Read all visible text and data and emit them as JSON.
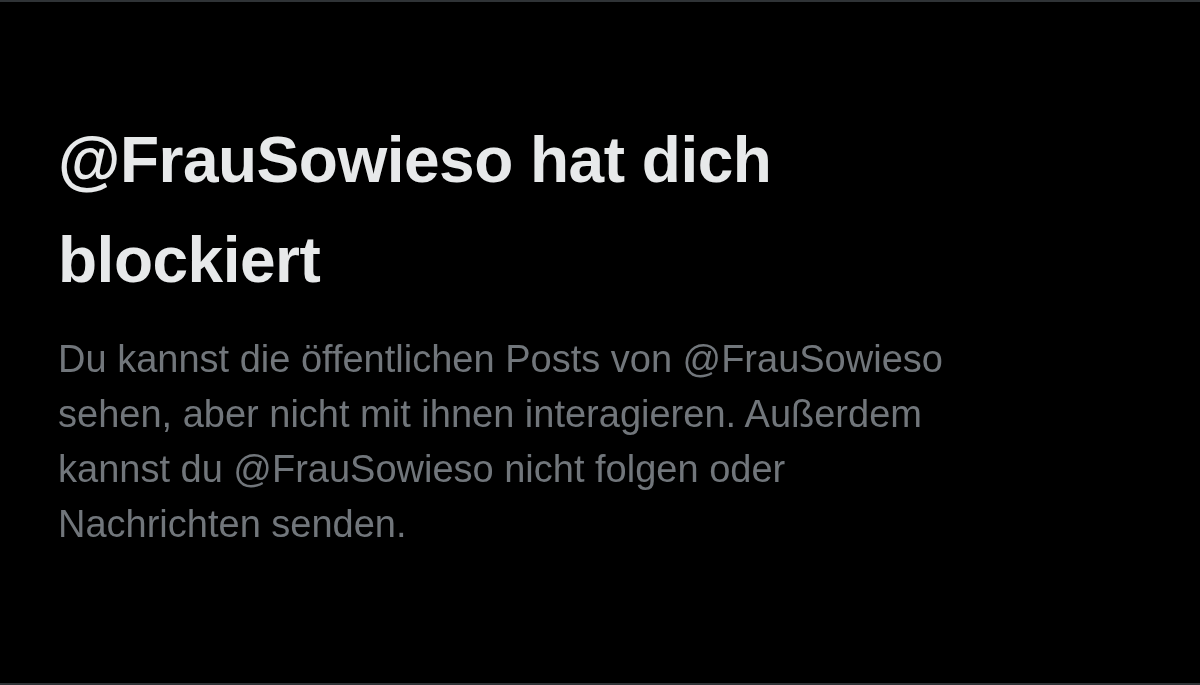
{
  "title": "@FrauSowieso hat dich blockiert",
  "message": "Du kannst die öffentlichen Posts von @FrauSowieso sehen, aber nicht mit ihnen interagieren. Außerdem kannst du @FrauSowieso nicht folgen oder Nachrichten senden."
}
